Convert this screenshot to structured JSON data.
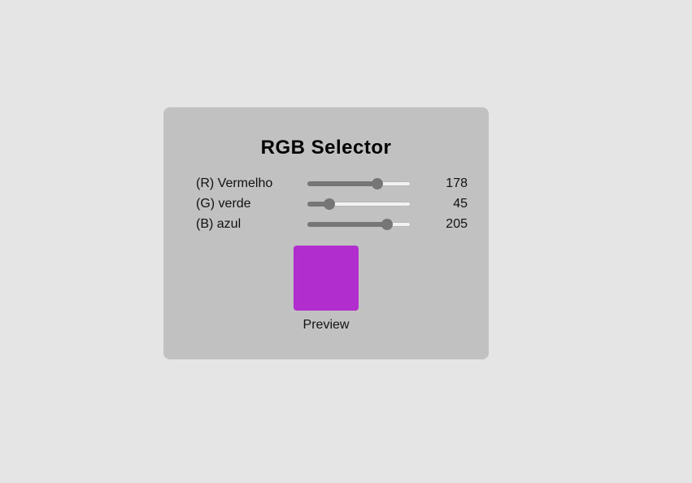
{
  "title": "RGB Selector",
  "channels": [
    {
      "label": "(R) Vermelho",
      "value": "178",
      "level": 178,
      "max": 255
    },
    {
      "label": "(G) verde",
      "value": "45",
      "level": 45,
      "max": 255
    },
    {
      "label": "(B) azul",
      "value": "205",
      "level": 205,
      "max": 255
    }
  ],
  "preview": {
    "label": "Preview",
    "color": "#b22dcd"
  },
  "colors": {
    "page_background": "#e5e5e5",
    "card_background": "#c1c1c1",
    "slider_fill": "#767676"
  }
}
